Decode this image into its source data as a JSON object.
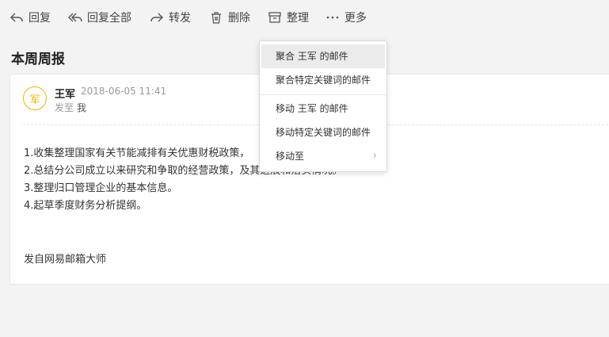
{
  "toolbar": {
    "reply": "回复",
    "reply_all": "回复全部",
    "forward": "转发",
    "delete": "删除",
    "organize": "整理",
    "more": "更多"
  },
  "email": {
    "subject": "本周周报",
    "avatar_char": "军",
    "sender": "王军",
    "date": "2018-06-05 11:41",
    "to_label": "发至",
    "to_name": "我",
    "body": [
      "1.收集整理国家有关节能减排有关优惠财税政策，",
      "2.总结分公司成立以来研究和争取的经营政策，及其进展和落实情况。",
      "3.整理归口管理企业的基本信息。",
      "4.起草季度财务分析提纲。"
    ],
    "signature": "发自网易邮箱大师"
  },
  "menu": {
    "items": [
      "聚合 王军 的邮件",
      "聚合特定关键词的邮件",
      "移动 王军 的邮件",
      "移动特定关键词的邮件",
      "移动至"
    ]
  },
  "colors": {
    "avatar_accent": "#f0b400",
    "background": "#f3f3f3",
    "menu_highlight": "#ebebeb"
  }
}
